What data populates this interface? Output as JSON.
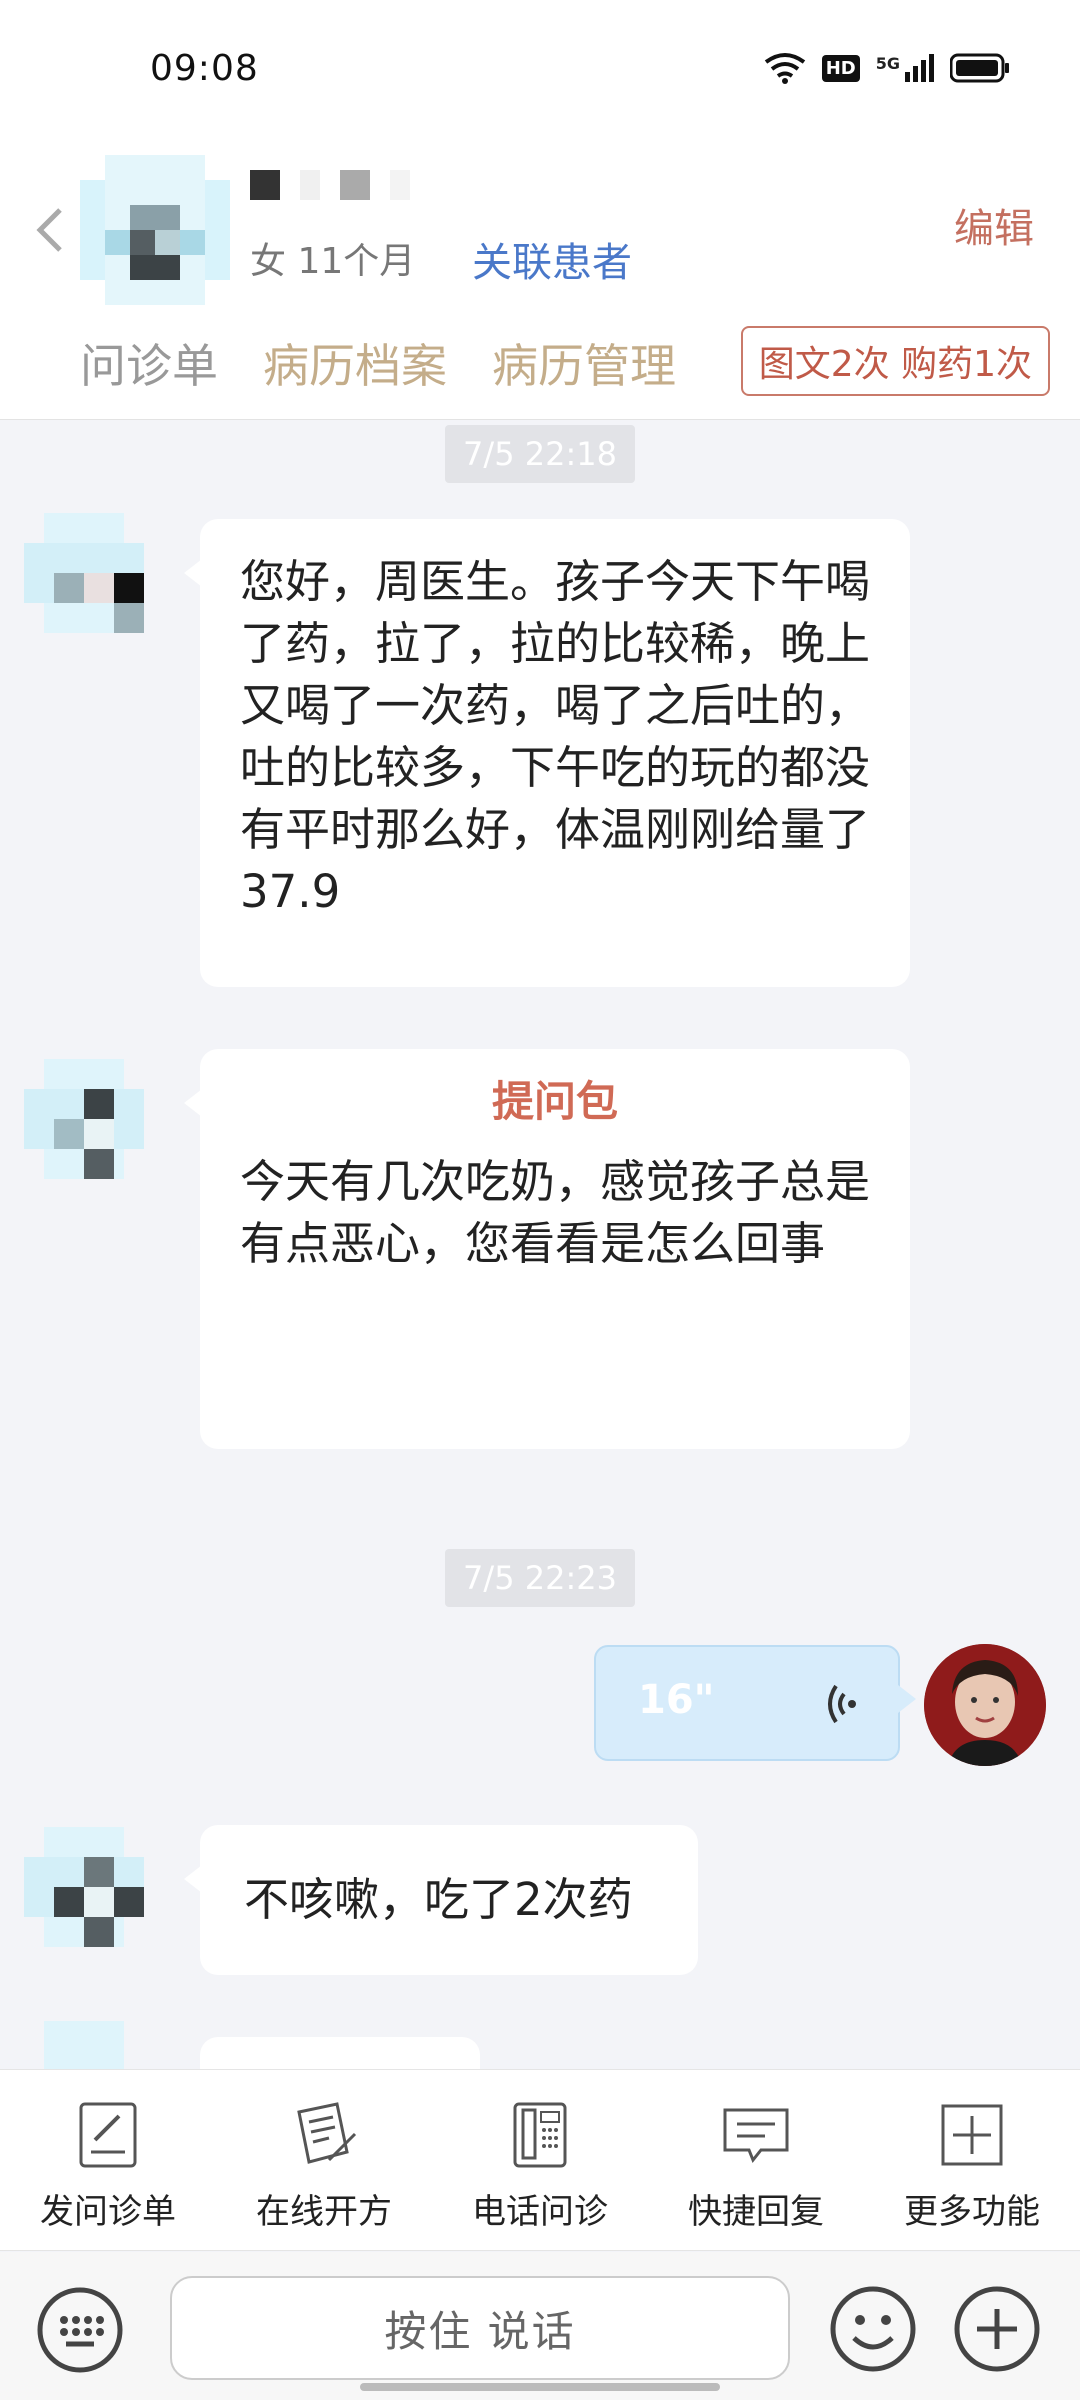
{
  "status_bar": {
    "time": "09:08",
    "hd": "HD",
    "network": "5G"
  },
  "header": {
    "patient_meta": "女 11个月",
    "link_patient": "关联患者",
    "edit": "编辑",
    "tabs": [
      "问诊单",
      "病历档案",
      "病历管理"
    ],
    "visit_badge": "图文2次 购药1次"
  },
  "chat": {
    "timestamps": [
      "7/5 22:18",
      "7/5 22:23"
    ],
    "messages": [
      {
        "text": "您好，周医生。孩子今天下午喝了药，拉了，拉的比较稀，晚上又喝了一次药，喝了之后吐的，吐的比较多，下午吃的玩的都没有平时那么好，体温刚刚给量了37.9"
      },
      {
        "title": "提问包",
        "text": "今天有几次吃奶，感觉孩子总是有点恶心，您看看是怎么回事"
      },
      {
        "voice_duration": "16\""
      },
      {
        "text": "不咳嗽，吃了2次药"
      }
    ]
  },
  "toolbar": {
    "items": [
      {
        "label": "发问诊单",
        "icon": "form-edit-icon"
      },
      {
        "label": "在线开方",
        "icon": "prescription-icon"
      },
      {
        "label": "电话问诊",
        "icon": "phone-icon"
      },
      {
        "label": "快捷回复",
        "icon": "message-icon"
      },
      {
        "label": "更多功能",
        "icon": "plus-square-icon"
      }
    ]
  },
  "input_bar": {
    "hold_to_talk": "按住 说话"
  },
  "colors": {
    "accent": "#c05a48",
    "link": "#4a78c9",
    "tab": "#c4ad8a",
    "voice_bubble": "#d7ecfb"
  }
}
